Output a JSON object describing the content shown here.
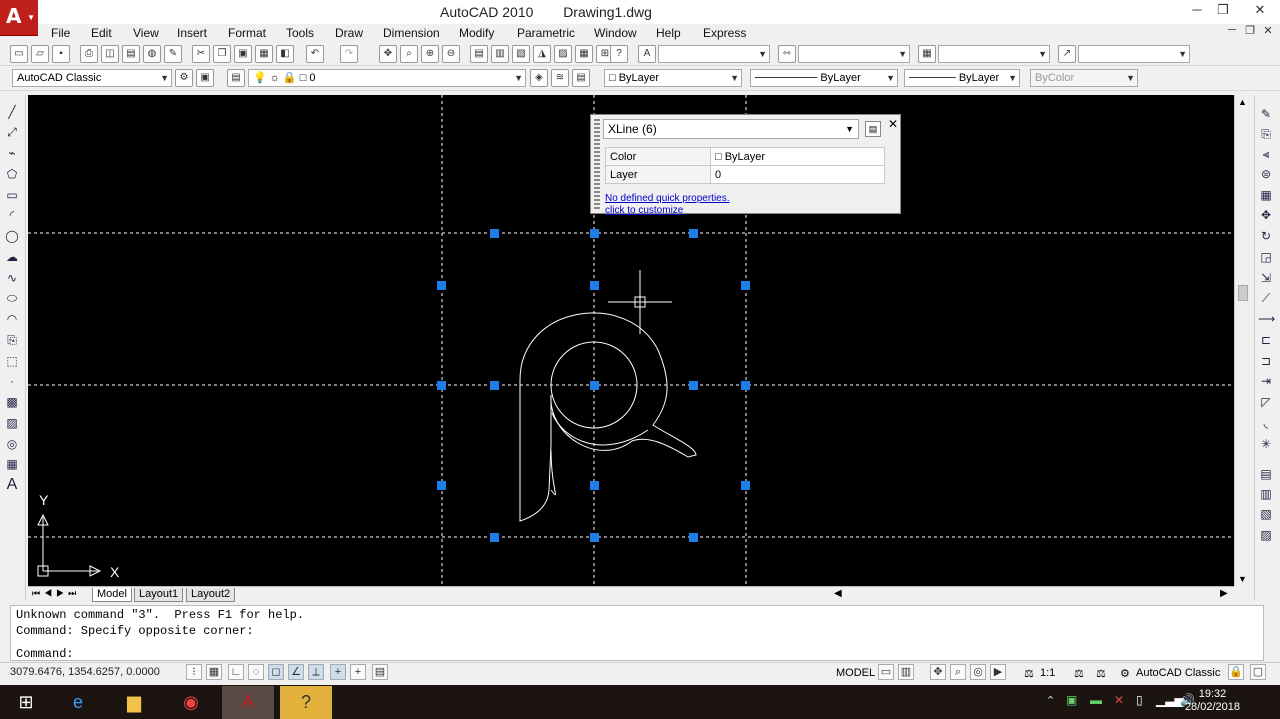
{
  "app": {
    "name": "AutoCAD 2010",
    "document": "Drawing1.dwg",
    "logo": "A"
  },
  "menu": [
    "File",
    "Edit",
    "View",
    "Insert",
    "Format",
    "Tools",
    "Draw",
    "Dimension",
    "Modify",
    "Parametric",
    "Window",
    "Help",
    "Express"
  ],
  "toolbar": {
    "workspace": "AutoCAD Classic",
    "layer": "0",
    "color": "ByLayer",
    "linetype": "ByLayer",
    "lineweight": "ByLayer",
    "plotstyle": "ByColor"
  },
  "quick_properties": {
    "selection": "XLine (6)",
    "rows": [
      {
        "key": "Color",
        "value": "ByLayer"
      },
      {
        "key": "Layer",
        "value": "0"
      }
    ],
    "link_line1": "No defined quick properties.",
    "link_line2": "click to customize"
  },
  "ucs": {
    "x_label": "X",
    "y_label": "Y"
  },
  "layout_tabs": [
    "Model",
    "Layout1",
    "Layout2"
  ],
  "command_line": {
    "lines": [
      "Unknown command \"3\".  Press F1 for help.",
      "Command: Specify opposite corner:",
      "Command:"
    ]
  },
  "status": {
    "coords": "3079.6476, 1354.6257, 0.0000",
    "space": "MODEL",
    "scale": "1:1",
    "workspace": "AutoCAD Classic"
  },
  "taskbar": {
    "time": "19:32",
    "date": "28/02/2018"
  },
  "colors": {
    "canvas": "#000000",
    "grip": "#1e7ee8",
    "accent": "#c0201c"
  }
}
